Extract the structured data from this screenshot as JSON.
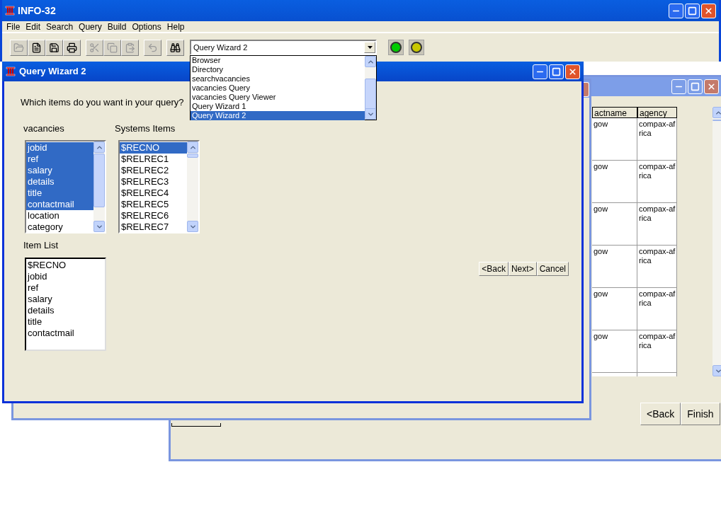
{
  "window": {
    "title": "INFO-32"
  },
  "menu": [
    "File",
    "Edit",
    "Search",
    "Query",
    "Build",
    "Options",
    "Help"
  ],
  "toolbar": [
    {
      "kind": "open",
      "disabled": true
    },
    {
      "kind": "new",
      "disabled": false
    },
    {
      "kind": "save",
      "disabled": false
    },
    {
      "kind": "print",
      "disabled": false
    },
    {
      "kind": "cut",
      "disabled": true
    },
    {
      "kind": "copy",
      "disabled": true
    },
    {
      "kind": "paste",
      "disabled": true
    },
    {
      "kind": "undo",
      "disabled": true
    },
    {
      "kind": "find",
      "disabled": false
    }
  ],
  "view_selector": {
    "value": "Query Wizard 2",
    "options": [
      {
        "label": "Browser",
        "selected": false
      },
      {
        "label": "Directory",
        "selected": false
      },
      {
        "label": "searchvacancies",
        "selected": false
      },
      {
        "label": "vacancies Query",
        "selected": false
      },
      {
        "label": "vacancies Query Viewer",
        "selected": false
      },
      {
        "label": "Query Wizard 1",
        "selected": false
      },
      {
        "label": "Query Wizard 2",
        "selected": true
      }
    ]
  },
  "status_lights": [
    {
      "color": "#00cc00"
    },
    {
      "color": "#c8c800"
    }
  ],
  "back_window": {
    "columns": [
      "actname",
      "agency"
    ],
    "rows": [
      [
        "gow",
        "compax-africa"
      ],
      [
        "gow",
        "compax-africa"
      ],
      [
        "gow",
        "compax-africa"
      ],
      [
        "gow",
        "compax-africa"
      ],
      [
        "gow",
        "compax-africa"
      ],
      [
        "gow",
        "compax-africa"
      ]
    ],
    "buttons": [
      "<Back",
      "Finish"
    ]
  },
  "wizard": {
    "title": "Query Wizard 2",
    "question": "Which items do you want in your query?",
    "source_list": {
      "label": "vacancies",
      "items": [
        {
          "label": "jobid",
          "selected": true
        },
        {
          "label": "ref",
          "selected": true
        },
        {
          "label": "salary",
          "selected": true
        },
        {
          "label": "details",
          "selected": true
        },
        {
          "label": "title",
          "selected": true
        },
        {
          "label": "contactmail",
          "selected": true
        },
        {
          "label": "location",
          "selected": false
        },
        {
          "label": "category",
          "selected": false
        }
      ]
    },
    "system_list": {
      "label": "Systems Items",
      "items": [
        {
          "label": "$RECNO",
          "selected": true
        },
        {
          "label": "$RELREC1",
          "selected": false
        },
        {
          "label": "$RELREC2",
          "selected": false
        },
        {
          "label": "$RELREC3",
          "selected": false
        },
        {
          "label": "$RELREC4",
          "selected": false
        },
        {
          "label": "$RELREC5",
          "selected": false
        },
        {
          "label": "$RELREC6",
          "selected": false
        },
        {
          "label": "$RELREC7",
          "selected": false
        }
      ]
    },
    "item_list": {
      "label": "Item List",
      "items": [
        "$RECNO",
        "jobid",
        "ref",
        "salary",
        "details",
        "title",
        "contactmail"
      ]
    },
    "buttons": [
      "<Back",
      "Next>",
      "Cancel"
    ]
  }
}
